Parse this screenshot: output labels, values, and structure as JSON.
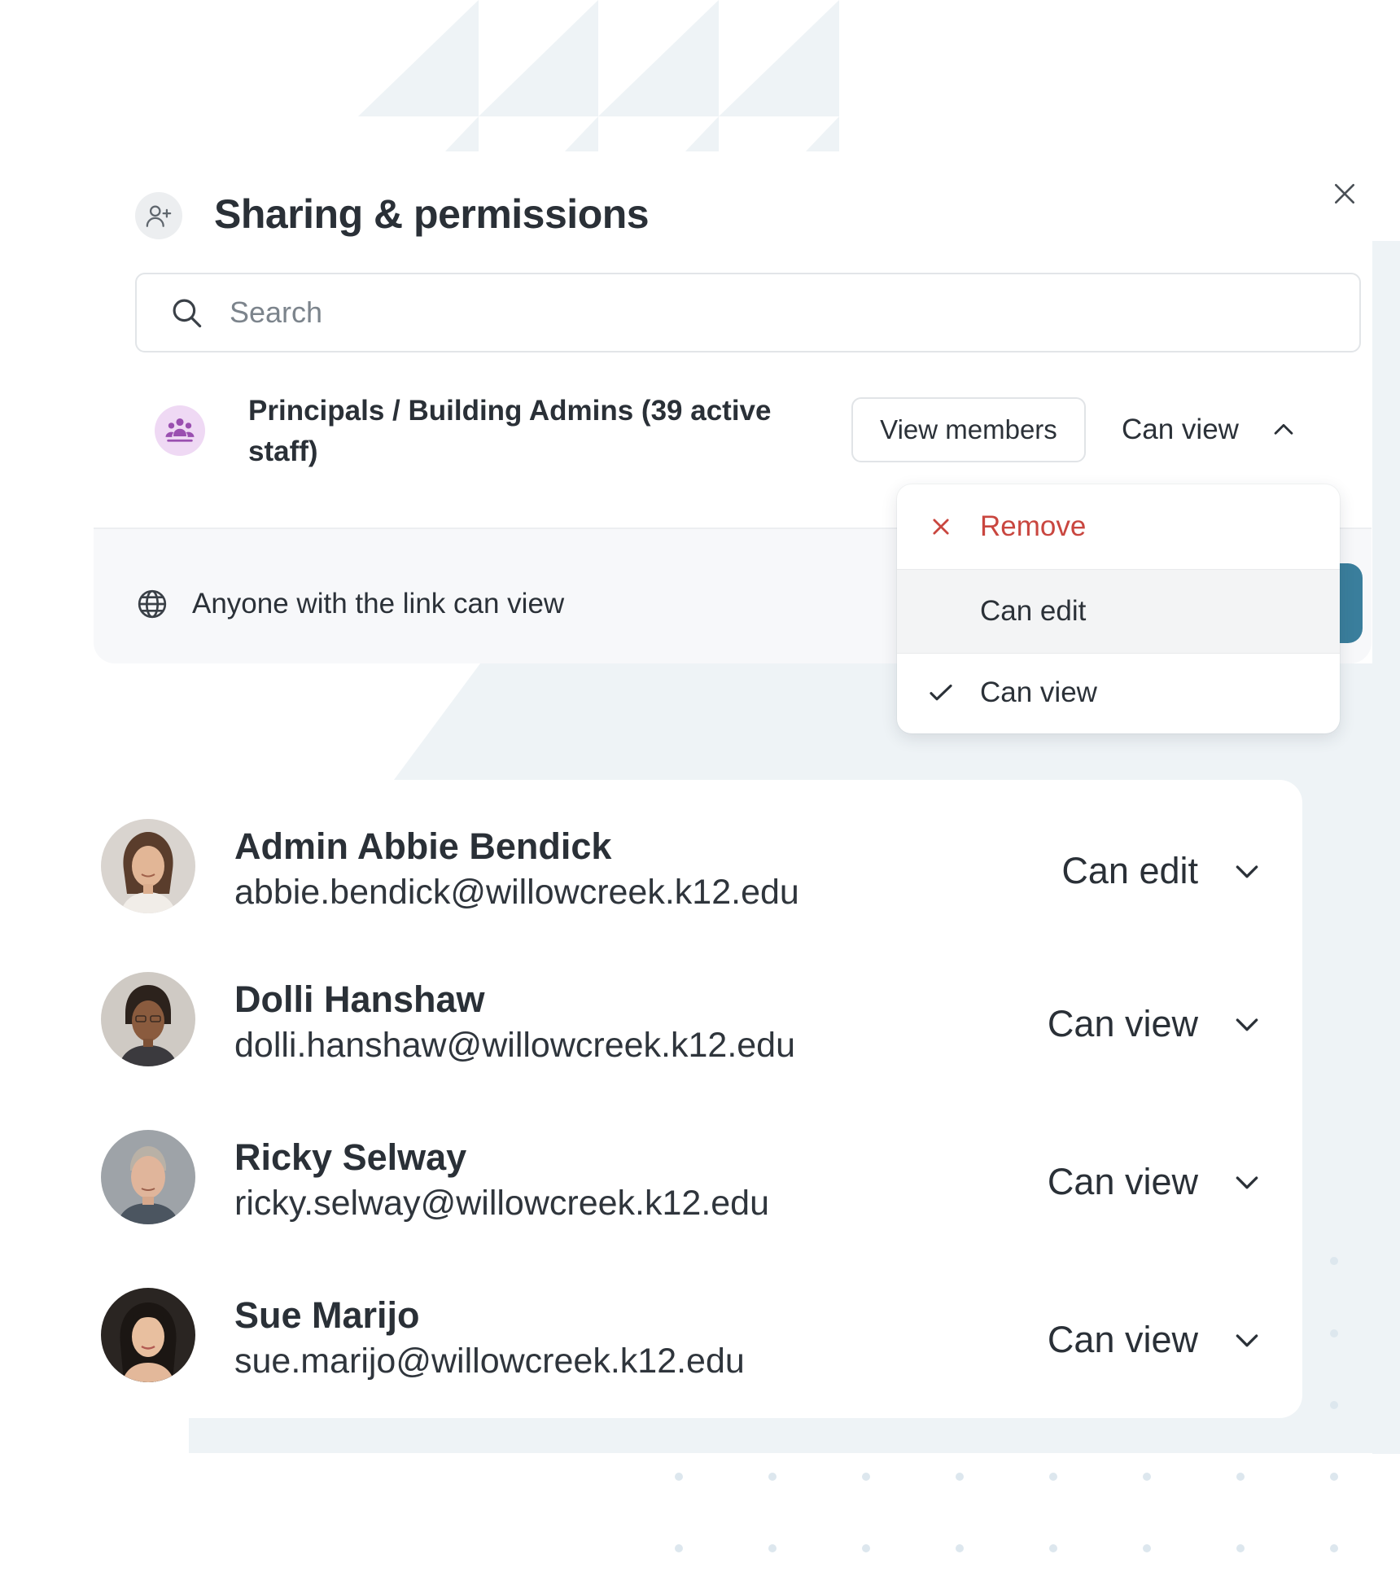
{
  "dialog": {
    "title": "Sharing & permissions",
    "icon": "add-user-icon",
    "close_icon": "close-icon"
  },
  "search": {
    "placeholder": "Search",
    "value": "",
    "icon": "search-icon"
  },
  "group": {
    "name": "Principals / Building Admins (39 active staff)",
    "icon": "group-icon",
    "view_members_label": "View members",
    "permission": "Can view",
    "permission_icon": "chevron-up-icon"
  },
  "permission_menu": {
    "items": [
      {
        "label": "Remove",
        "icon": "x-icon",
        "color": "#c9463f"
      },
      {
        "label": "Can edit",
        "icon": "",
        "highlighted": true
      },
      {
        "label": "Can view",
        "icon": "check-icon",
        "selected": true
      }
    ]
  },
  "link_sharing": {
    "text": "Anyone with the link can view",
    "icon": "globe-icon",
    "accent": "#3a7e9c"
  },
  "people": [
    {
      "name": "Admin Abbie Bendick",
      "email": "abbie.bendick@willowcreek.k12.edu",
      "permission": "Can edit"
    },
    {
      "name": "Dolli Hanshaw",
      "email": "dolli.hanshaw@willowcreek.k12.edu",
      "permission": "Can view"
    },
    {
      "name": "Ricky Selway",
      "email": "ricky.selway@willowcreek.k12.edu",
      "permission": "Can view"
    },
    {
      "name": "Sue Marijo",
      "email": "sue.marijo@willowcreek.k12.edu",
      "permission": "Can view"
    }
  ]
}
